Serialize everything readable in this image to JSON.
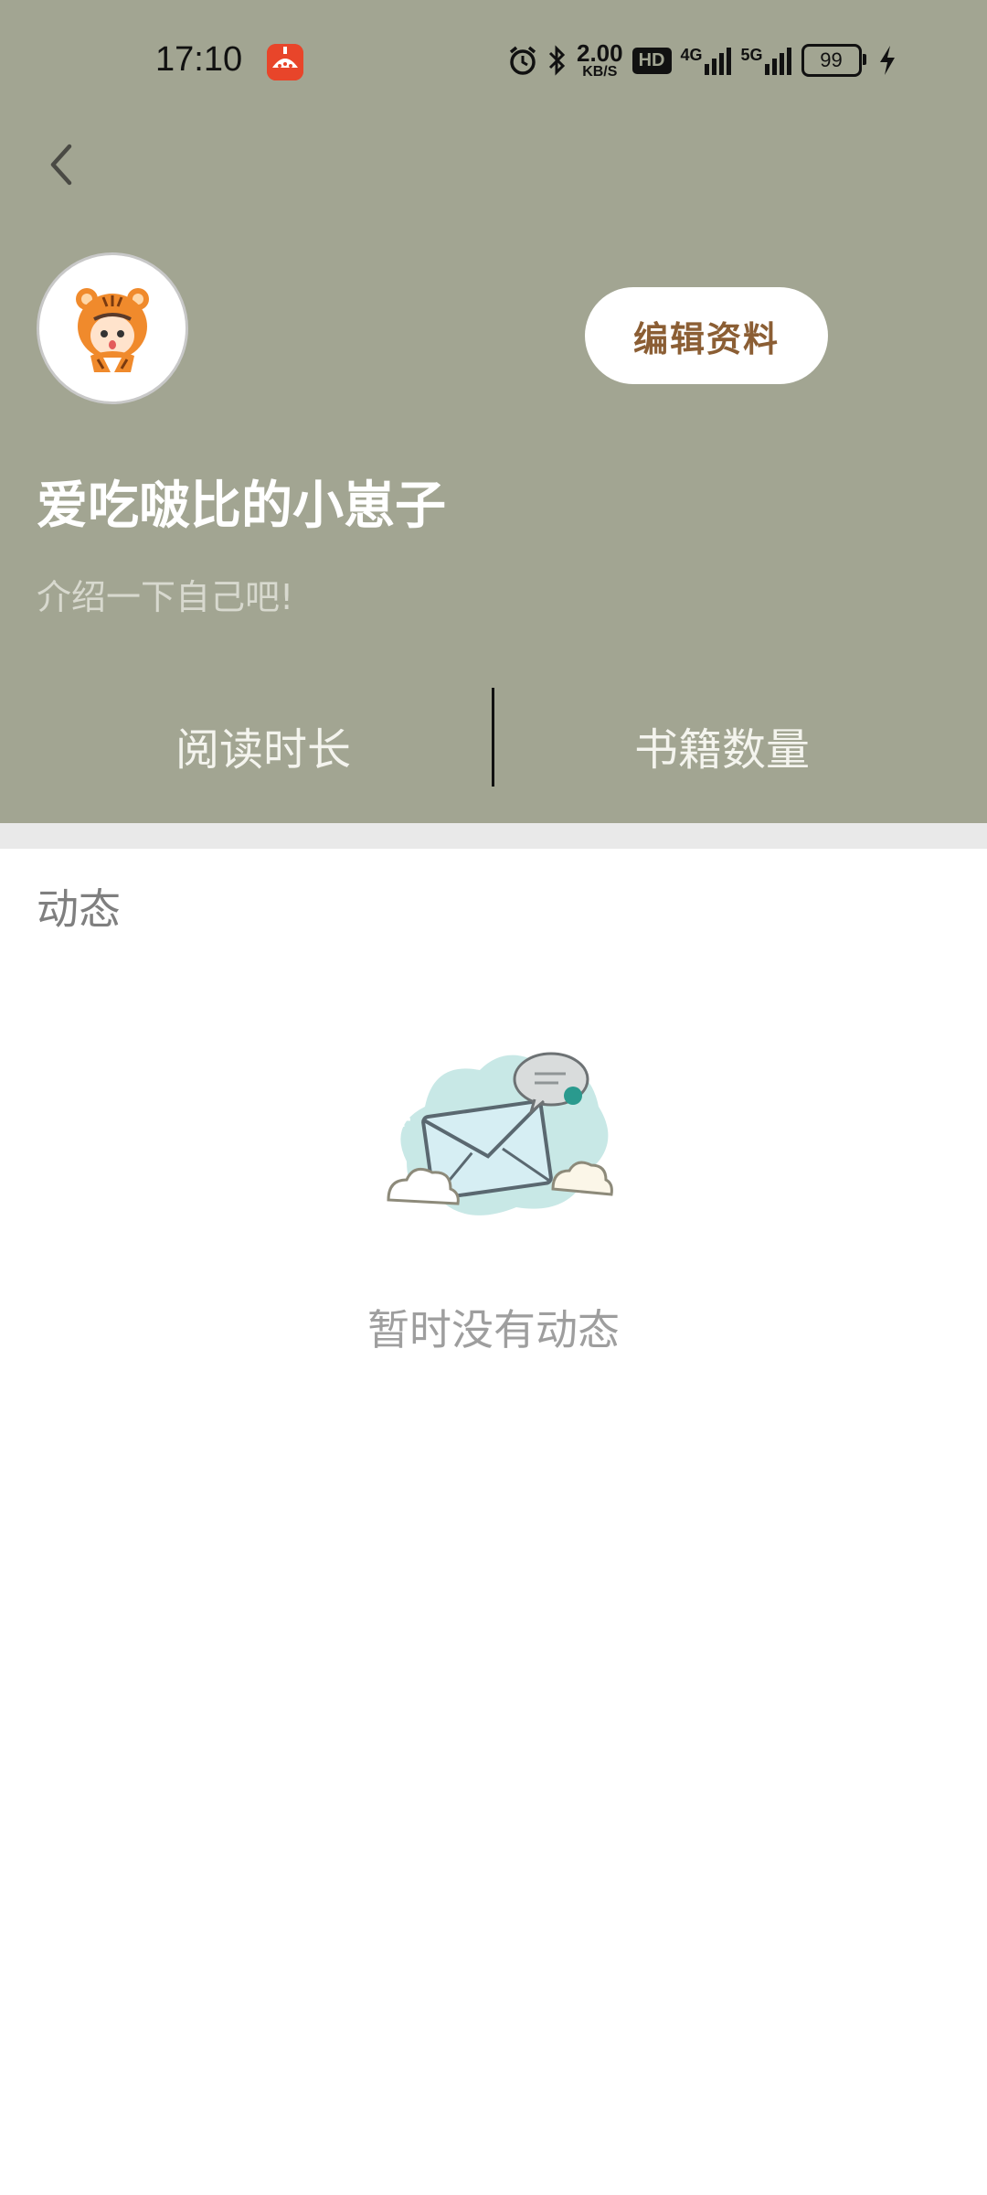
{
  "status_bar": {
    "time": "17:10",
    "net_speed_value": "2.00",
    "net_speed_unit": "KB/S",
    "hd_badge": "HD",
    "net_4g": "4G",
    "net_5g": "5G",
    "battery": "99",
    "icons": [
      "app-notification-icon",
      "alarm-icon",
      "bluetooth-icon",
      "signal-4g-icon",
      "signal-5g-icon",
      "battery-icon",
      "charging-icon"
    ]
  },
  "header": {
    "background_color": "#a2a592",
    "back_icon": "chevron-left-icon",
    "edit_profile_label": "编辑资料",
    "username": "爱吃啵比的小崽子",
    "bio_placeholder": "介绍一下自己吧!",
    "stats": [
      {
        "label": "阅读时长"
      },
      {
        "label": "书籍数量"
      }
    ]
  },
  "feed": {
    "section_title": "动态",
    "empty_icon": "empty-mail-illustration",
    "empty_text": "暂时没有动态"
  }
}
